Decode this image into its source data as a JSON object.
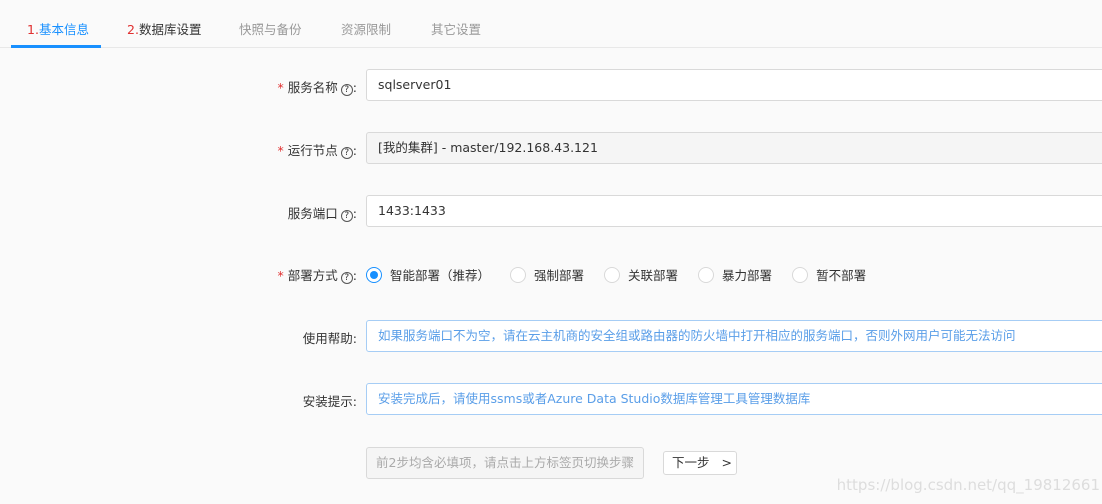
{
  "tabs": [
    {
      "num": "1.",
      "label": "基本信息"
    },
    {
      "num": "2.",
      "label": "数据库设置"
    },
    {
      "num": "",
      "label": "快照与备份"
    },
    {
      "num": "",
      "label": "资源限制"
    },
    {
      "num": "",
      "label": "其它设置"
    }
  ],
  "form": {
    "required_mark": "*",
    "help_mark": "?",
    "service_name": {
      "label": "服务名称",
      "value": "sqlserver01"
    },
    "node": {
      "label": "运行节点",
      "value": "[我的集群] - master/192.168.43.121"
    },
    "port": {
      "label": "服务端口",
      "value": "1433:1433"
    },
    "deploy": {
      "label": "部署方式",
      "options": [
        "智能部署（推荐）",
        "强制部署",
        "关联部署",
        "暴力部署",
        "暂不部署"
      ],
      "selected": 0
    },
    "help": {
      "label": "使用帮助:",
      "value": "如果服务端口不为空，请在云主机商的安全组或路由器的防火墙中打开相应的服务端口，否则外网用户可能无法访问"
    },
    "install": {
      "label": "安装提示:",
      "value": "安装完成后，请使用ssms或者Azure Data Studio数据库管理工具管理数据库"
    }
  },
  "footer": {
    "hint": "前2步均含必填项，请点击上方标签页切换步骤",
    "next": "下一步",
    "next_icon": ">"
  },
  "watermark": "https://blog.csdn.net/qq_19812661"
}
